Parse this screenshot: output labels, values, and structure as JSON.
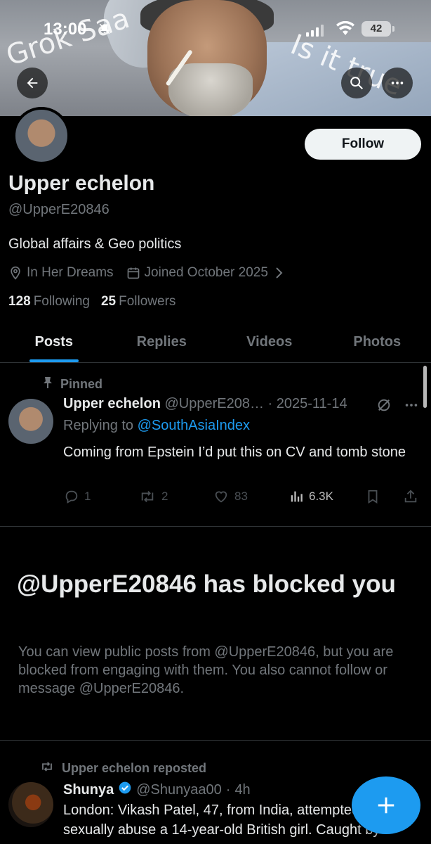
{
  "status_bar": {
    "time": "13:00",
    "battery": "42"
  },
  "banner": {
    "overlay_left": "Grok Saa",
    "overlay_right": "Is it true"
  },
  "profile": {
    "follow_label": "Follow",
    "name": "Upper echelon",
    "handle": "@UpperE20846",
    "bio": "Global affairs & Geo politics",
    "location": "In Her Dreams",
    "joined": "Joined October 2025",
    "following_count": "128",
    "following_label": "Following",
    "followers_count": "25",
    "followers_label": "Followers"
  },
  "tabs": [
    {
      "label": "Posts",
      "active": true
    },
    {
      "label": "Replies",
      "active": false
    },
    {
      "label": "Videos",
      "active": false
    },
    {
      "label": "Photos",
      "active": false
    }
  ],
  "pinned_post": {
    "pinned_label": "Pinned",
    "author": "Upper echelon",
    "handle": "@UpperE208…",
    "separator": "·",
    "date": "2025-11-14",
    "replying_prefix": "Replying to",
    "replying_to": "@SouthAsiaIndex",
    "text": "Coming from Epstein I’d put this on CV and tomb stone",
    "replies": "1",
    "reposts": "2",
    "likes": "83",
    "views": "6.3K"
  },
  "blocked": {
    "title": "@UpperE20846 has blocked you",
    "message": "You can view public posts from @UpperE20846, but you are blocked from engaging with them. You also cannot follow or message @UpperE20846."
  },
  "repost": {
    "label": "Upper echelon reposted",
    "author": "Shunya",
    "handle": "@Shunyaa00",
    "separator": "·",
    "time": "4h",
    "text": "London: Vikash Patel, 47, from India, attempted to sexually abuse a 14-year-old British girl. Caught by"
  },
  "colors": {
    "accent": "#1d9bf0",
    "background": "#000000",
    "muted": "#71767b",
    "text": "#e7e9ea"
  }
}
